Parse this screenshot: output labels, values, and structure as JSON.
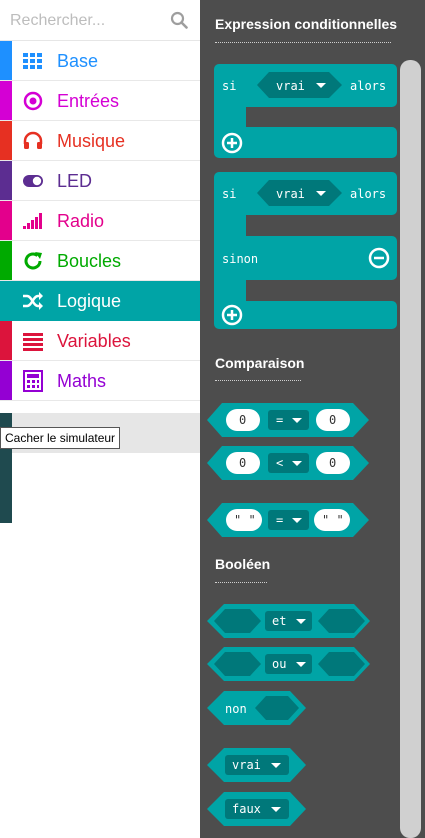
{
  "search": {
    "placeholder": "Rechercher..."
  },
  "categories": [
    {
      "label": "Base",
      "color": "#1e90ff",
      "icon": "grid-icon"
    },
    {
      "label": "Entrées",
      "color": "#d400d4",
      "icon": "target-icon"
    },
    {
      "label": "Musique",
      "color": "#e63022",
      "icon": "headphones-icon"
    },
    {
      "label": "LED",
      "color": "#5c2d91",
      "icon": "toggle-icon"
    },
    {
      "label": "Radio",
      "color": "#e3008c",
      "icon": "signal-bars-icon"
    },
    {
      "label": "Boucles",
      "color": "#00aa00",
      "icon": "refresh-icon"
    },
    {
      "label": "Logique",
      "color": "#00a4a6",
      "icon": "shuffle-icon",
      "selected": true
    },
    {
      "label": "Variables",
      "color": "#dc143c",
      "icon": "list-icon"
    },
    {
      "label": "Maths",
      "color": "#9400d3",
      "icon": "calculator-icon"
    }
  ],
  "tooltip": "Cacher le simulateur",
  "flyout": {
    "sections": {
      "conditionals": "Expression conditionnelles",
      "comparison": "Comparaison",
      "boolean": "Booléen"
    },
    "blocks": {
      "si": "si",
      "alors": "alors",
      "sinon": "sinon",
      "vrai": "vrai",
      "faux": "faux",
      "et": "et",
      "ou": "ou",
      "non": "non",
      "zero": "0",
      "eq": "=",
      "lt": "<",
      "empty_string": "\" \""
    }
  },
  "colors": {
    "logic": "#00a4a6",
    "logic_dark": "#00787a",
    "flyout_bg": "#4d4d4d",
    "selected_bg": "#00a4a6"
  }
}
